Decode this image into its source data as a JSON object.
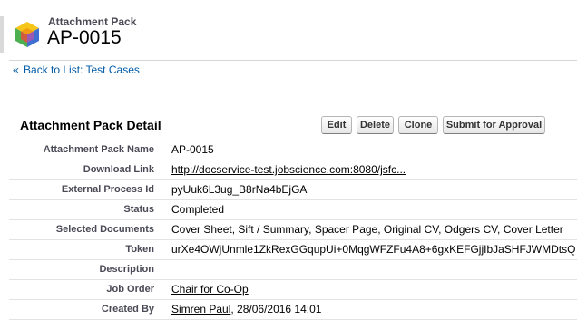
{
  "header": {
    "object_type": "Attachment Pack",
    "record_name": "AP-0015",
    "icon": "cube-icon"
  },
  "nav": {
    "back_prefix": "«",
    "back_link": "Back to List: Test Cases"
  },
  "detail": {
    "title": "Attachment Pack Detail",
    "buttons": {
      "edit": "Edit",
      "delete": "Delete",
      "clone": "Clone",
      "submit": "Submit for Approval"
    },
    "fields": [
      {
        "label": "Attachment Pack Name",
        "value": "AP-0015"
      },
      {
        "label": "Download Link",
        "value": "http://docservice-test.jobscience.com:8080/jsfc..."
      },
      {
        "label": "External Process Id",
        "value": "pyUuk6L3ug_B8rNa4bEjGA"
      },
      {
        "label": "Status",
        "value": "Completed"
      },
      {
        "label": "Selected Documents",
        "value": "Cover Sheet, Sift / Summary, Spacer Page, Original CV, Odgers CV, Cover Letter"
      },
      {
        "label": "Token",
        "value": "urXe4OWjUnmle1ZkRexGGqupUi+0MqgWFZFu4A8+6gxKEFGjjIbJaSHFJWMDtsQ"
      },
      {
        "label": "Description",
        "value": ""
      },
      {
        "label": "Job Order",
        "value": "Chair for Co-Op"
      },
      {
        "label": "Created By",
        "value_link": "Simren Paul",
        "value_rest": ", 28/06/2016 14:01"
      }
    ]
  },
  "colors": {
    "link_blue": "#015ba7",
    "label_gray": "#4a4a56",
    "row_divider": "#e3e3e7"
  }
}
